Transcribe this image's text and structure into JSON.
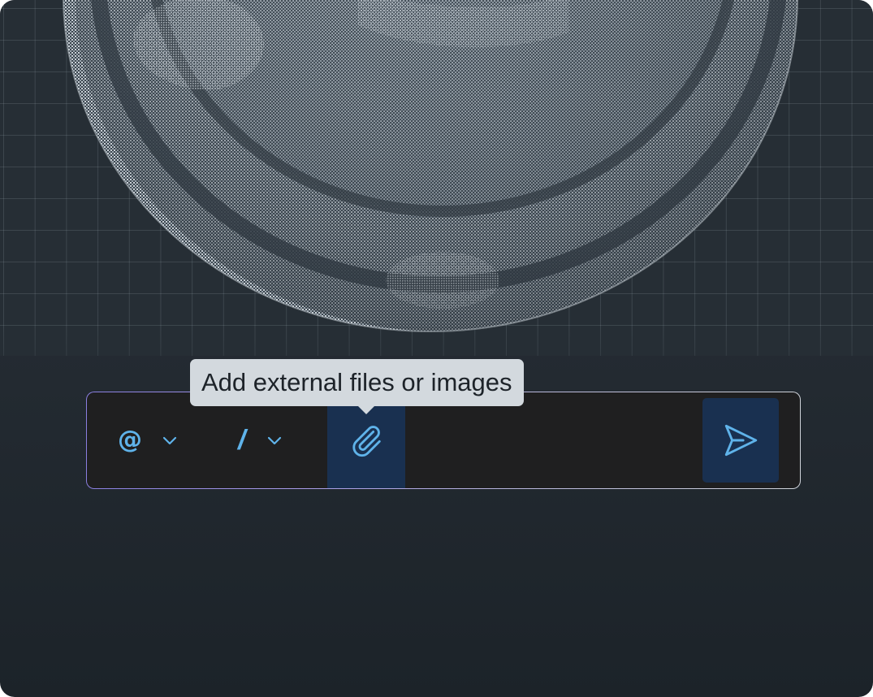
{
  "composer": {
    "mention_trigger": "@",
    "command_trigger": "/",
    "attach_icon": "paperclip-icon",
    "send_icon": "send-icon",
    "message_value": ""
  },
  "tooltip": {
    "text": "Add external files or images"
  },
  "colors": {
    "accent": "#5fb3ea",
    "button_bg": "#193050",
    "composer_bg": "#1f1f20",
    "tooltip_bg": "#d3d9de",
    "page_bg": "#232a31"
  }
}
